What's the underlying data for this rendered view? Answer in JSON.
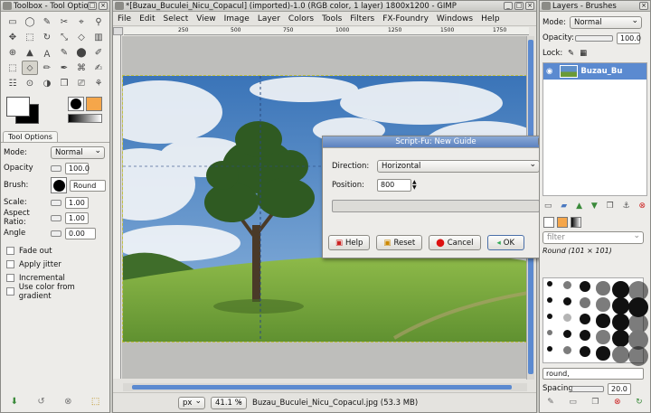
{
  "toolbox": {
    "title": "Toolbox - Tool Options",
    "options_tab": "Tool Options",
    "mode_label": "Mode:",
    "mode_value": "Normal",
    "opacity_label": "Opacity",
    "opacity_value": "100.0",
    "brush_label": "Brush:",
    "brush_value": "Round",
    "scale_label": "Scale:",
    "scale_value": "1.00",
    "aspect_label": "Aspect Ratio:",
    "aspect_value": "1.00",
    "angle_label": "Angle",
    "angle_value": "0.00",
    "fade_out": "Fade out",
    "apply_jitter": "Apply jitter",
    "incremental": "Incremental",
    "use_gradient": "Use color from gradient",
    "tools": [
      "▭",
      "◯",
      "✎",
      "✂",
      "⌖",
      "⚲",
      "✥",
      "⬚",
      "↻",
      "⤡",
      "◇",
      "▥",
      "⊕",
      "▲",
      "Ａ",
      "✎",
      "⬤",
      "✐",
      "⬚",
      "⬦",
      "✏",
      "✒",
      "⌘",
      "✍",
      "☷",
      "⊙",
      "◑",
      "❒",
      "⎚",
      "⚘"
    ]
  },
  "image_window": {
    "title": "*[Buzau_Buculei_Nicu_Copacul] (imported)-1.0 (RGB color, 1 layer) 1800x1200 - GIMP",
    "menu": [
      "File",
      "Edit",
      "Select",
      "View",
      "Image",
      "Layer",
      "Colors",
      "Tools",
      "Filters",
      "FX-Foundry",
      "Windows",
      "Help"
    ],
    "ruler_labels": [
      "250",
      "500",
      "750",
      "1000",
      "1250",
      "1500",
      "1750"
    ],
    "unit": "px",
    "zoom": "41.1 %",
    "status_file": "Buzau_Buculei_Nicu_Copacul.jpg (53.3 MB)"
  },
  "dialog": {
    "title": "Script-Fu: New Guide",
    "direction_label": "Direction:",
    "direction_value": "Horizontal",
    "position_label": "Position:",
    "position_value": "800",
    "help": "Help",
    "reset": "Reset",
    "cancel": "Cancel",
    "ok": "OK"
  },
  "layers": {
    "title": "Layers - Brushes",
    "mode_label": "Mode:",
    "mode_value": "Normal",
    "opacity_label": "Opacity:",
    "opacity_value": "100.0",
    "lock_label": "Lock:",
    "layer_name": "Buzau_Bu",
    "filter_placeholder": "filter",
    "brush_name": "Round (101 × 101)",
    "brush_tag": "round,",
    "spacing_label": "Spacing",
    "spacing_value": "20.0"
  },
  "colors": {
    "accent": "#5b8ad0",
    "fg": "#000000",
    "bg": "#ffffff",
    "dialog_title": "#5c82bf"
  }
}
